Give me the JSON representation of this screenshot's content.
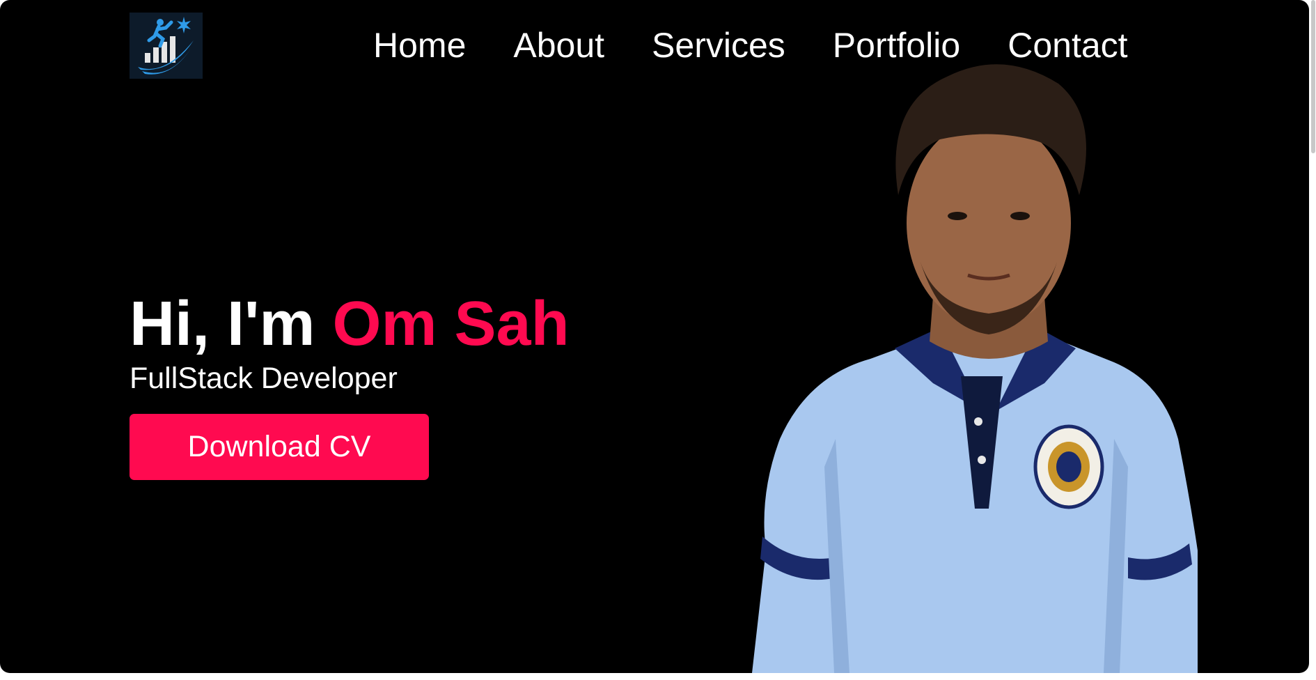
{
  "header": {
    "logo_icon": "growth-chart-runner-logo",
    "nav": [
      {
        "label": "Home"
      },
      {
        "label": "About"
      },
      {
        "label": "Services"
      },
      {
        "label": "Portfolio"
      },
      {
        "label": "Contact"
      }
    ]
  },
  "hero": {
    "greeting": "Hi, I'm ",
    "name": "Om Sah",
    "role": "FullStack Developer",
    "cta_label": "Download CV",
    "portrait_icon": "profile-photo"
  },
  "colors": {
    "background": "#000000",
    "accent": "#ff0a50",
    "text": "#ffffff"
  }
}
